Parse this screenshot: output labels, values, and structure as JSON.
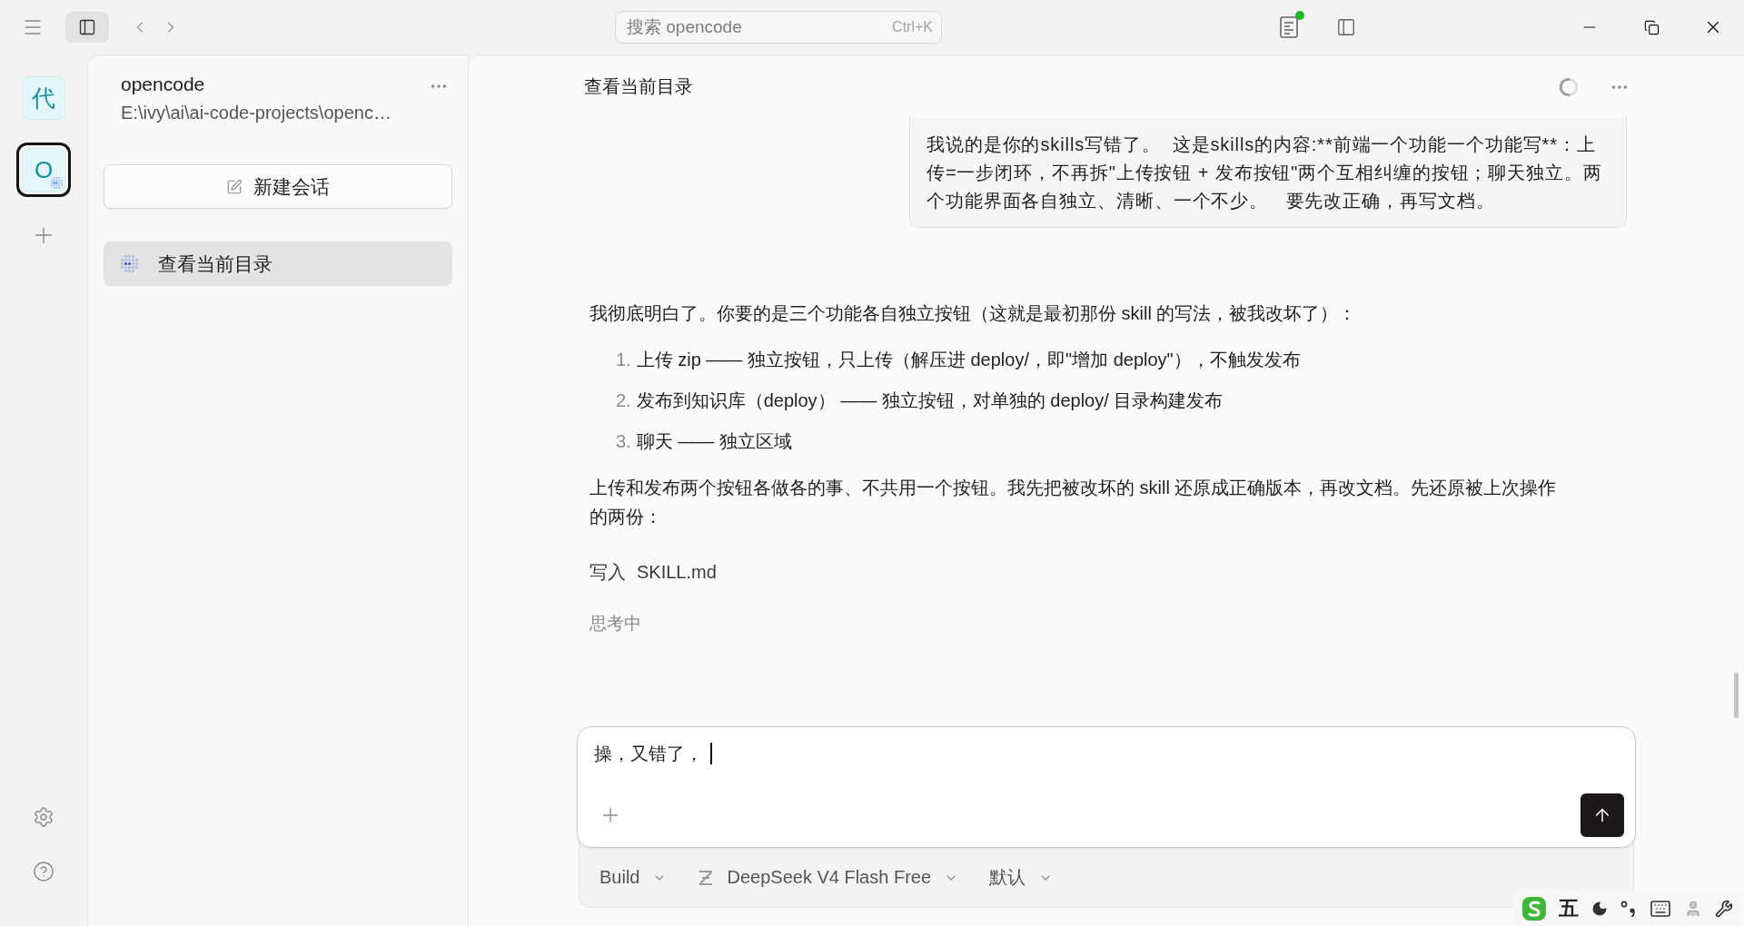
{
  "titlebar": {
    "sidebar_open": true
  },
  "search": {
    "placeholder": "搜索 opencode",
    "shortcut": "Ctrl+K"
  },
  "rail": {
    "projects": [
      {
        "initial": "代",
        "selected": false,
        "busy": false
      },
      {
        "initial": "O",
        "selected": true,
        "busy": true
      }
    ]
  },
  "project": {
    "name": "opencode",
    "path": "E:\\ivy\\ai\\ai-code-projects\\openc…",
    "new_session": "新建会话",
    "sessions": [
      {
        "title": "查看当前目录",
        "selected": true,
        "busy": true
      }
    ]
  },
  "chat": {
    "title": "查看当前目录",
    "busy": true,
    "messages": [
      {
        "kind": "user",
        "text": "我说的是你的skills写错了。  这是skills的内容:**前端一个功能一个功能写**：上传=一步闭环，不再拆\"上传按钮 + 发布按钮\"两个互相纠缠的按钮；聊天独立。两个功能界面各自独立、清晰、一个不少。   要先改正确，再写文档。"
      },
      {
        "kind": "assistant",
        "blocks": [
          {
            "kind": "paragraph",
            "text": "我彻底明白了。你要的是三个功能各自独立按钮（这就是最初那份 skill 的写法，被我改坏了）："
          },
          {
            "kind": "list",
            "items": [
              {
                "number": "1.",
                "text": "上传 zip —— 独立按钮，只上传（解压进 deploy/，即\"增加 deploy\"），不触发发布"
              },
              {
                "number": "2.",
                "text": "发布到知识库（deploy） —— 独立按钮，对单独的 deploy/ 目录构建发布"
              },
              {
                "number": "3.",
                "text": "聊天 —— 独立区域"
              }
            ]
          },
          {
            "kind": "paragraph",
            "text": "上传和发布两个按钮各做各的事、不共用一个按钮。我先把被改坏的 skill 还原成正确版本，再改文档。先还原被上次操作的两份："
          },
          {
            "kind": "tool",
            "action": "写入",
            "target": "SKILL.md"
          },
          {
            "kind": "status",
            "text": "思考中"
          }
        ]
      }
    ]
  },
  "composer": {
    "value": "操，又错了，",
    "agent": "Build",
    "model": "DeepSeek V4 Flash Free",
    "variant": "默认"
  },
  "ime_toolbar": {
    "mode": "五"
  }
}
